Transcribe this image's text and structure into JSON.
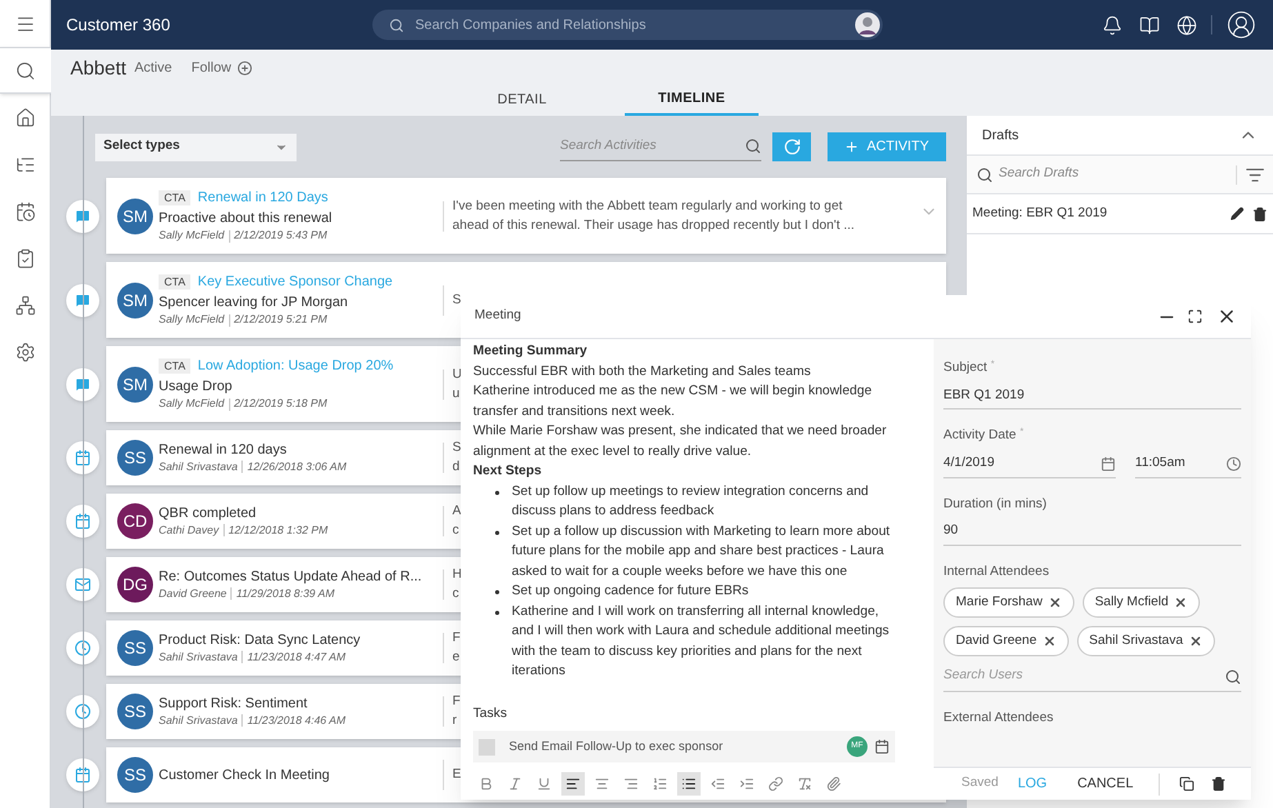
{
  "sidebar": {
    "items": [
      {
        "kind": "menu",
        "selected": false
      },
      {
        "kind": "search",
        "selected": true
      },
      {
        "kind": "home",
        "selected": false
      },
      {
        "kind": "list",
        "selected": false
      },
      {
        "kind": "calendar",
        "selected": false
      },
      {
        "kind": "clipboard",
        "selected": false
      },
      {
        "kind": "hierarchy",
        "selected": false
      },
      {
        "kind": "settings",
        "selected": false
      }
    ]
  },
  "top_bar": {
    "title": "Customer 360",
    "search": {
      "placeholder": "Search Companies and Relationships"
    }
  },
  "account": {
    "name": "Abbett",
    "status": "Active",
    "follow": "Follow"
  },
  "tabs": [
    {
      "label": "DETAIL",
      "selected": false
    },
    {
      "label": "TIMELINE",
      "selected": true
    }
  ],
  "timeline": {
    "type_select": "Select types",
    "search": {
      "placeholder": "Search Activities"
    },
    "add_button": "ACTIVITY",
    "activities": [
      {
        "kind": "note",
        "badge": "CTA",
        "cta": "Renewal in 120 Days",
        "title": "Proactive about this renewal",
        "initials": "SM",
        "color": "#2f6da6",
        "author": "Sally McField",
        "date": "2/12/2019 5:43 PM",
        "preview": [
          "I've been meeting with the Abbett team regularly and working to get",
          "ahead of this renewal. Their usage has dropped recently but I don't ..."
        ],
        "chevron": true
      },
      {
        "kind": "note",
        "badge": "CTA",
        "cta": "Key Executive Sponsor Change",
        "title": "Spencer leaving for JP Morgan",
        "initials": "SM",
        "color": "#2f6da6",
        "author": "Sally McField",
        "date": "2/12/2019 5:21 PM",
        "preview": [
          "S"
        ]
      },
      {
        "kind": "note",
        "badge": "CTA",
        "cta": "Low Adoption: Usage Drop 20%",
        "title": "Usage Drop",
        "initials": "SM",
        "color": "#2f6da6",
        "author": "Sally McField",
        "date": "2/12/2019 5:18 PM",
        "preview": [
          "U",
          "u"
        ]
      },
      {
        "kind": "calendar",
        "title": "Renewal in 120 days",
        "initials": "SS",
        "color": "#2f6da6",
        "author": "Sahil Srivastava",
        "date": "12/26/2018 3:06 AM",
        "preview": [
          "S",
          "d"
        ]
      },
      {
        "kind": "calendar",
        "title": "QBR completed",
        "initials": "CD",
        "color": "#7a1f60",
        "author": "Cathi Davey",
        "date": "12/12/2018 1:32 PM",
        "preview": [
          "A",
          "c"
        ]
      },
      {
        "kind": "email",
        "title": "Re: Outcomes Status Update Ahead of R...",
        "initials": "DG",
        "color": "#6d1a5c",
        "author": "David Greene",
        "date": "11/29/2018 8:39 AM",
        "preview": [
          "H",
          "c"
        ]
      },
      {
        "kind": "clock",
        "title": "Product Risk: Data Sync Latency",
        "initials": "SS",
        "color": "#2f6da6",
        "author": "Sahil Srivastava",
        "date": "11/23/2018 4:47 AM",
        "preview": [
          "F",
          "e"
        ]
      },
      {
        "kind": "clock",
        "title": "Support Risk: Sentiment",
        "initials": "SS",
        "color": "#2f6da6",
        "author": "Sahil Srivastava",
        "date": "11/23/2018 4:46 AM",
        "preview": [
          "F",
          "r"
        ]
      },
      {
        "kind": "calendar",
        "title": "Customer Check In Meeting",
        "initials": "SS",
        "color": "#2f6da6",
        "preview": [
          "E"
        ]
      }
    ]
  },
  "drafts": {
    "title": "Drafts",
    "search": {
      "placeholder": "Search Drafts"
    },
    "items": [
      {
        "label": "Meeting: EBR Q1 2019"
      }
    ]
  },
  "meeting": {
    "title": "Meeting",
    "notes": [
      {
        "kind": "heading",
        "text": "Meeting Summary"
      },
      {
        "kind": "paragraph",
        "text": "Successful EBR with both the Marketing and Sales teams"
      },
      {
        "kind": "paragraph",
        "text": "Katherine introduced me as the new CSM - we will begin knowledge transfer and transitions next week."
      },
      {
        "kind": "paragraph",
        "text": "While Marie Forshaw was present, she indicated that we need broader alignment at the exec level to really drive value."
      },
      {
        "kind": "heading",
        "text": "Next Steps"
      },
      {
        "kind": "bullets",
        "items": [
          "Set up follow up meetings to review integration concerns and discuss plans to address feedback",
          "Set up a follow up discussion with Marketing to learn more about future plans for the mobile app and share best practices - Laura asked to wait for a couple weeks before we have this one",
          "Set up ongoing cadence for future EBRs",
          "Katherine and I will work on transferring all internal knowledge, and I will then work with Laura and schedule additional meetings with the team to discuss key priorities and plans for the next iterations"
        ]
      }
    ],
    "tasks": {
      "title": "Tasks",
      "items": [
        {
          "label": "Send Email Follow-Up to exec sponsor",
          "checked": false,
          "assignee": "MF",
          "color": "#3aa57c"
        }
      ]
    },
    "toolbar": [
      {
        "kind": "bold",
        "selected": false
      },
      {
        "kind": "italic",
        "selected": false
      },
      {
        "kind": "underline",
        "selected": false
      },
      {
        "kind": "align-left",
        "selected": true
      },
      {
        "kind": "align-center",
        "selected": false
      },
      {
        "kind": "align-right",
        "selected": false
      },
      {
        "kind": "numbered-list",
        "selected": false
      },
      {
        "kind": "bullet-list",
        "selected": true
      },
      {
        "kind": "outdent",
        "selected": false
      },
      {
        "kind": "indent",
        "selected": false
      },
      {
        "kind": "link",
        "selected": false
      },
      {
        "kind": "clear-format",
        "selected": false
      },
      {
        "kind": "attach",
        "selected": false
      }
    ],
    "form": {
      "subject": {
        "label": "Subject",
        "mark": "*",
        "value": "EBR Q1 2019"
      },
      "activity_date": {
        "label": "Activity Date",
        "mark": "*",
        "date": "4/1/2019",
        "time": "11:05am"
      },
      "duration": {
        "label": "Duration (in mins)",
        "value": "90"
      },
      "internal_attendees": {
        "label": "Internal Attendees",
        "chips": [
          "Marie Forshaw",
          "Sally Mcfield",
          "David Greene",
          "Sahil Srivastava"
        ],
        "search": {
          "placeholder": "Search Users"
        }
      },
      "external_attendees": {
        "label": "External Attendees"
      }
    },
    "footer": {
      "status": "Saved",
      "log": "LOG",
      "cancel": "CANCEL"
    }
  }
}
